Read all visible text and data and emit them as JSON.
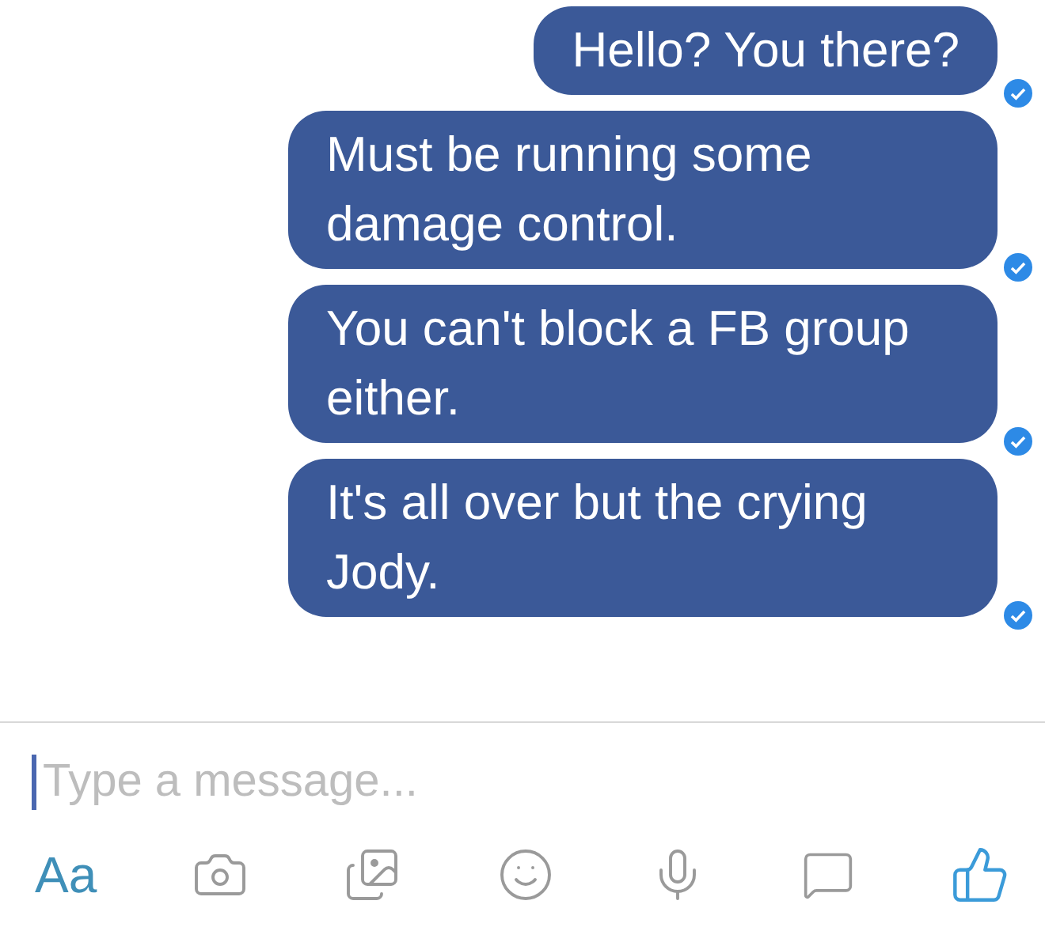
{
  "messages": [
    {
      "text": "Hello? You there?",
      "delivered": true
    },
    {
      "text": "Must be running some damage control.",
      "delivered": true
    },
    {
      "text": "You can't block a FB group either.",
      "delivered": true
    },
    {
      "text": "It's all over but the crying Jody.",
      "delivered": true
    }
  ],
  "composer": {
    "placeholder": "Type a message..."
  },
  "toolbar": {
    "text_button": "Aa"
  }
}
